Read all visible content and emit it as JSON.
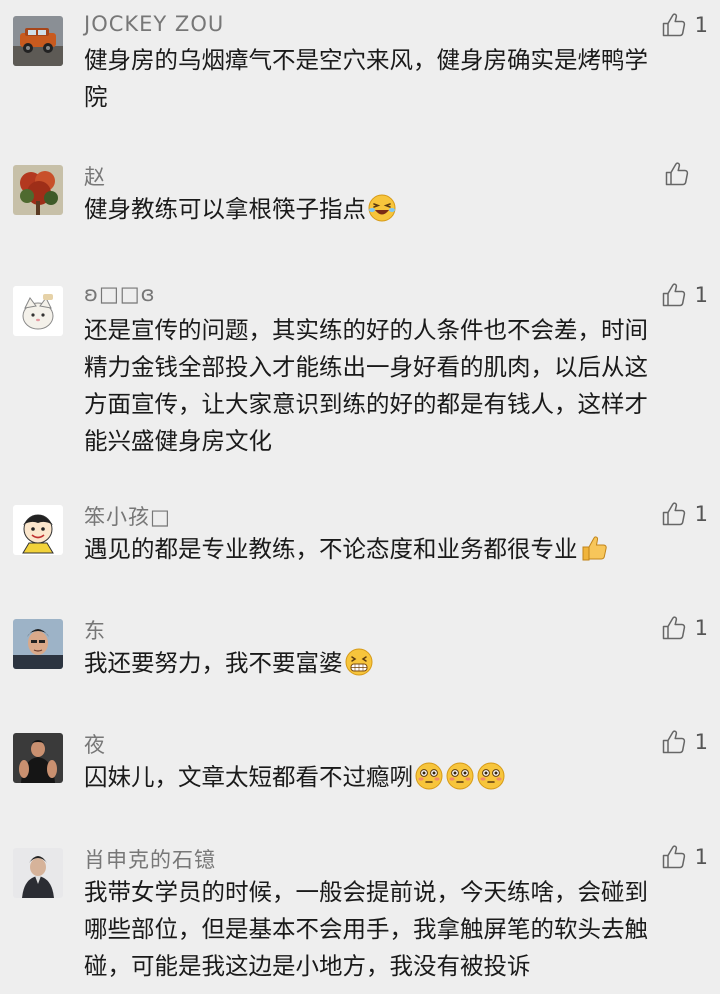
{
  "comments": [
    {
      "author": "JOCKEY ZOU",
      "likes": "1",
      "lines": [
        "健身房的乌烟瘴气不是空穴来风，健身房确实是烤鸭学",
        "院"
      ],
      "avatar_icon": "car-avatar",
      "trailing_emoji": []
    },
    {
      "author": "赵",
      "likes": "",
      "lines": [
        "健身教练可以拿根筷子指点"
      ],
      "avatar_icon": "tree-avatar",
      "trailing_emoji": [
        "laugh-cry-emoji"
      ]
    },
    {
      "author": "ʚ□□ɞ",
      "likes": "1",
      "lines": [
        "还是宣传的问题，其实练的好的人条件也不会差，时间",
        "精力金钱全部投入才能练出一身好看的肌肉，以后从这",
        "方面宣传，让大家意识到练的好的都是有钱人，这样才",
        "能兴盛健身房文化"
      ],
      "avatar_icon": "cartoon-cat-avatar",
      "trailing_emoji": []
    },
    {
      "author": "笨小孩□",
      "likes": "1",
      "lines": [
        "遇见的都是专业教练，不论态度和业务都很专业"
      ],
      "avatar_icon": "cartoon-kid-avatar",
      "trailing_emoji": [
        "thumbs-up-emoji"
      ]
    },
    {
      "author": "东",
      "likes": "1",
      "lines": [
        "我还要努力，我不要富婆"
      ],
      "avatar_icon": "man-portrait-avatar",
      "trailing_emoji": [
        "grin-emoji"
      ]
    },
    {
      "author": "夜",
      "likes": "1",
      "lines": [
        "囚妹儿，文章太短都看不过瘾咧"
      ],
      "avatar_icon": "muscle-man-avatar",
      "trailing_emoji": [
        "flushed-emoji",
        "flushed-emoji",
        "flushed-emoji"
      ]
    },
    {
      "author": "肖申克的石镱",
      "likes": "1",
      "lines": [
        "我带女学员的时候，一般会提前说，今天练啥，会碰到",
        "哪些部位，但是基本不会用手，我拿触屏笔的软头去触",
        "碰，可能是我这边是小地方，我没有被投诉"
      ],
      "avatar_icon": "person-portrait-avatar",
      "trailing_emoji": []
    }
  ],
  "colors": {
    "background": "#eeeeee",
    "author_text": "#777777",
    "body_text": "#1a1a1a",
    "like_icon": "#666666",
    "divider": "#dcdcdc"
  }
}
